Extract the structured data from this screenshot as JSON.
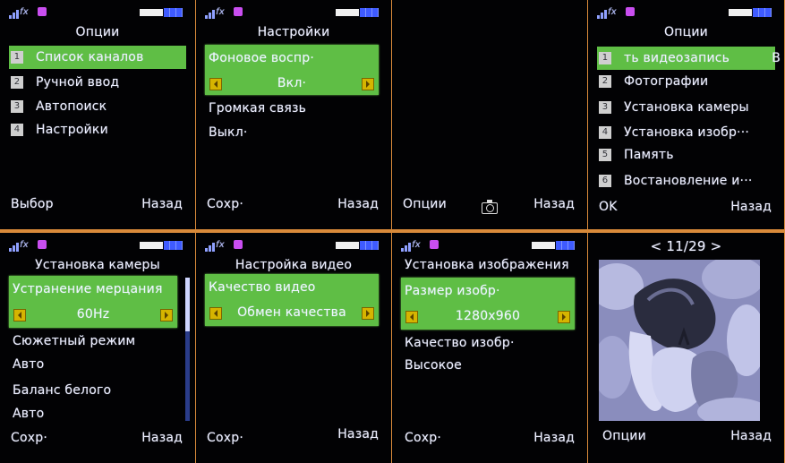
{
  "screen1": {
    "title": "Опции",
    "items": [
      {
        "num": "1",
        "label": "Список каналов"
      },
      {
        "num": "2",
        "label": "Ручной ввод"
      },
      {
        "num": "3",
        "label": "Автопоиск"
      },
      {
        "num": "4",
        "label": "Настройки"
      }
    ],
    "softkey_left": "Выбор",
    "softkey_right": "Назад"
  },
  "screen2": {
    "title": "Настройки",
    "selected_label": "Фоновое воспр·",
    "selected_value": "Вкл·",
    "row1": "Громкая связь",
    "row2": "Выкл·",
    "softkey_left": "Сохр·",
    "softkey_right": "Назад"
  },
  "screen3": {
    "softkey_left": "Опции",
    "center_icon": "camera-icon",
    "softkey_right": "Назад"
  },
  "screen4": {
    "title": "Опции",
    "items": [
      {
        "num": "1",
        "label": "ть видеозапись"
      },
      {
        "num": "2",
        "label": "Фотографии"
      },
      {
        "num": "3",
        "label": "Установка камеры"
      },
      {
        "num": "4",
        "label": "Установка изобр···"
      },
      {
        "num": "5",
        "label": "Память"
      },
      {
        "num": "6",
        "label": "Востановление и···"
      }
    ],
    "item1_trail": "В",
    "softkey_left": "OK",
    "softkey_right": "Назад"
  },
  "screen5": {
    "title": "Установка камеры",
    "selected_label": "Устранение мерцания",
    "selected_value": "60Hz",
    "row1": "Сюжетный режим",
    "row2": "Авто",
    "row3": "Баланс белого",
    "row4": "Авто",
    "softkey_left": "Сохр·",
    "softkey_right": "Назад"
  },
  "screen6": {
    "title": "Настройка видео",
    "selected_label": "Качество видео",
    "selected_value": "Обмен качества",
    "softkey_left": "Сохр·",
    "softkey_right": "Назад"
  },
  "screen7": {
    "title": "Установка изображения",
    "selected_label": "Размер изобр·",
    "selected_value": "1280x960",
    "row1": "Качество изобр·",
    "row2": "Высокое",
    "softkey_left": "Сохр·",
    "softkey_right": "Назад"
  },
  "screen8": {
    "counter": "< 11/29 >",
    "softkey_left": "Опции",
    "softkey_right": "Назад"
  },
  "colors": {
    "highlight": "#5fbe45",
    "screen_bg": "#020204",
    "frame": "#d98a3a",
    "text": "#eef0ff"
  }
}
